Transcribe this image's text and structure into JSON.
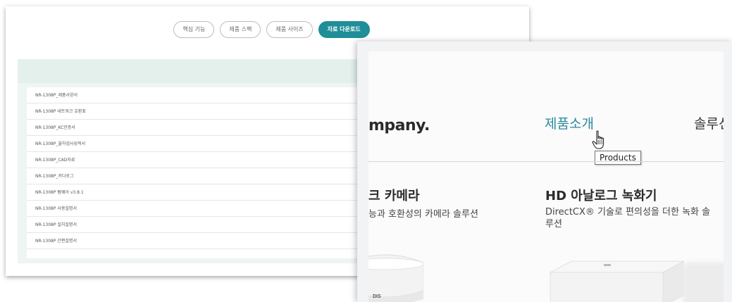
{
  "download_page": {
    "tabs": [
      {
        "label": "핵심 기능",
        "active": false
      },
      {
        "label": "제품 스펙",
        "active": false
      },
      {
        "label": "제품 사이즈",
        "active": false
      },
      {
        "label": "자료 다운로드",
        "active": true
      }
    ],
    "files": [
      "NR-1308P_제품사양서",
      "NR-1308P 네트워크 호환표",
      "NR-1308P_KC인증서",
      "NR-1308P_울하검사성적서",
      "NR-1308P_CAD자료",
      "NR-1308P_카다로그",
      "NR-1308P 펌웨어 v3.8.1",
      "NR-1308P 사용설명서",
      "NR-1308P 설치설명서",
      "NR-1308P 간편설명서"
    ]
  },
  "product_menu": {
    "logo_fragment": "mpany.",
    "nav_product": "제품소개",
    "nav_solution": "솔루션",
    "tooltip": "Products",
    "camera_title": "크 카메라",
    "camera_desc": "능과 호환성의 카메라 솔루션",
    "hd_title": "HD 아날로그 녹화기",
    "hd_desc": "DirectCX® 기술로 편의성을 더한 녹화 솔루션",
    "camera_brand": "DIS"
  },
  "colors": {
    "accent": "#1f8e98",
    "nav_active": "#2a8a9d",
    "panel_bg": "#eef5f3"
  }
}
